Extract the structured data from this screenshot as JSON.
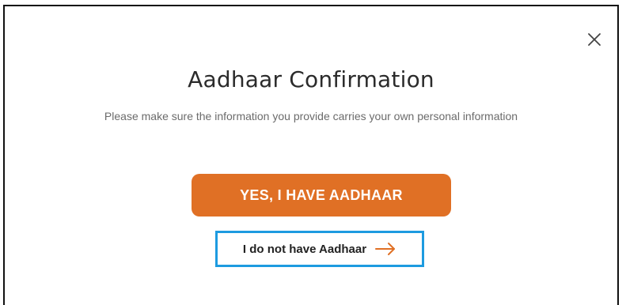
{
  "dialog": {
    "title": "Aadhaar Confirmation",
    "subtitle": "Please make sure the information you provide carries your own personal information",
    "close_icon": "close-icon",
    "primary_button_label": "YES, I HAVE AADHAAR",
    "secondary_link_label": "I do not have Aadhaar",
    "secondary_link_icon": "arrow-right-icon"
  },
  "colors": {
    "accent": "#e07025",
    "highlight_border": "#1d9be0",
    "title_text": "#2b2b2b",
    "subtitle_text": "#6b6b6b"
  }
}
